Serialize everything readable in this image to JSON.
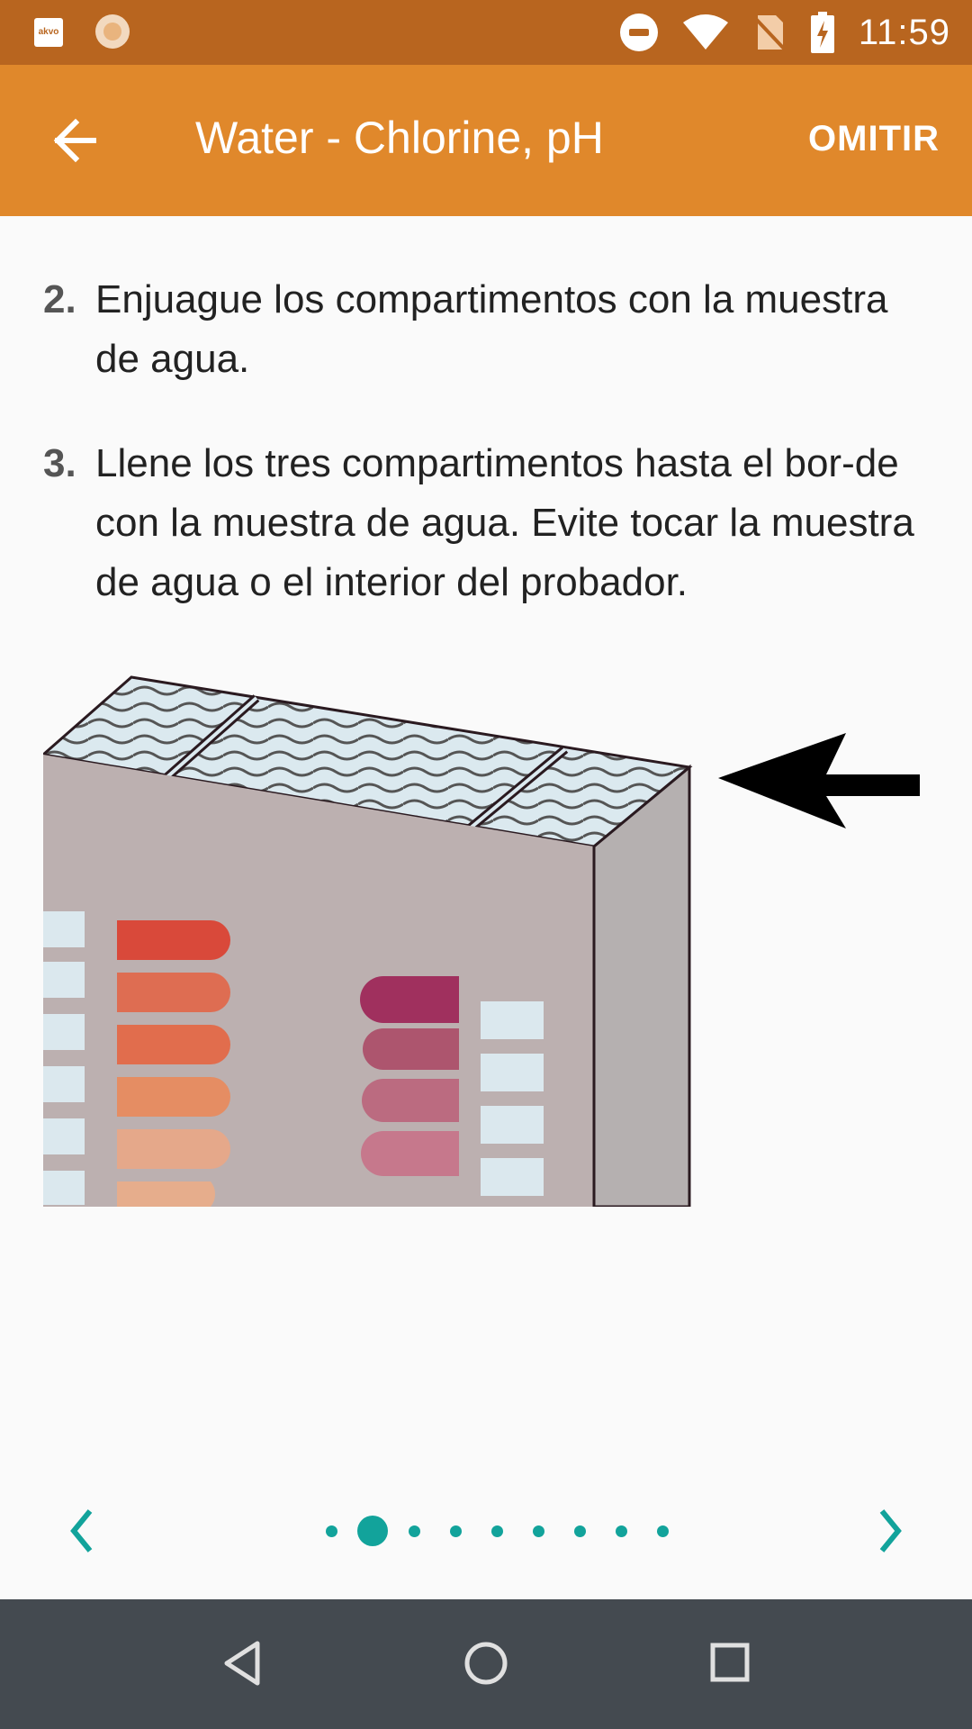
{
  "status_bar": {
    "time": "11:59",
    "notification_app_label": "akvo",
    "icons": [
      "akvo-app-icon",
      "sun-icon",
      "do-not-disturb-icon",
      "wifi-icon",
      "no-sim-icon",
      "battery-charging-icon"
    ]
  },
  "app_bar": {
    "title": "Water - Chlorine, pH",
    "skip_label": "OMITIR",
    "back_icon": "arrow-back-icon"
  },
  "steps": [
    {
      "number": "2.",
      "text": "Enjuague los compartimentos con la muestra de agua."
    },
    {
      "number": "3.",
      "text": "Llene los tres compartimentos hasta el bor-de con la muestra de agua. Evite tocar la muestra de agua o el interior del probador."
    }
  ],
  "pager": {
    "total_pages": 9,
    "current_page": 2,
    "accent_color": "#12a39b"
  },
  "colors": {
    "status_bar": "#b8651f",
    "app_bar": "#e0882b",
    "nav_bar": "#444a50"
  }
}
